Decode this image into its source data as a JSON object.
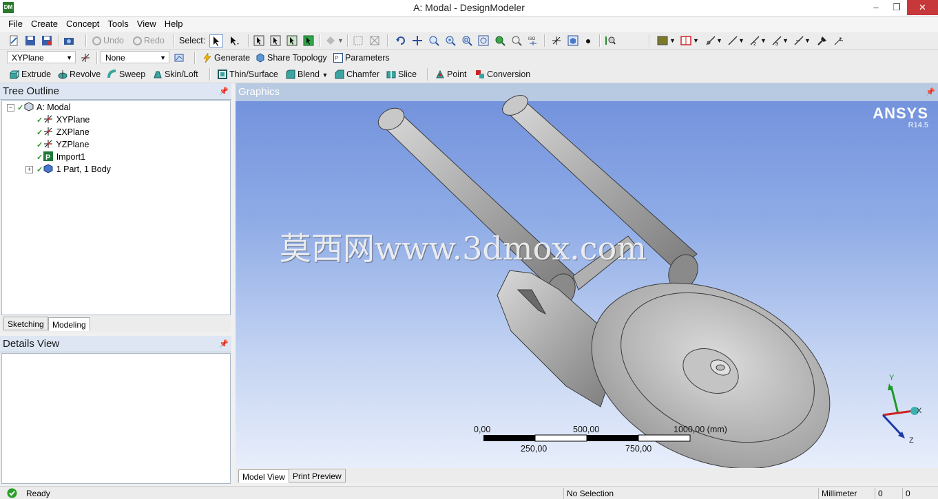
{
  "window": {
    "title": "A: Modal - DesignModeler",
    "app_icon": "DM"
  },
  "menu": [
    "File",
    "Create",
    "Concept",
    "Tools",
    "View",
    "Help"
  ],
  "toolbar1": {
    "undo": "Undo",
    "redo": "Redo",
    "select_label": "Select:"
  },
  "toolbar2": {
    "plane": "XYPlane",
    "sketch": "None",
    "generate": "Generate",
    "share_topology": "Share Topology",
    "parameters": "Parameters"
  },
  "toolbar3": {
    "extrude": "Extrude",
    "revolve": "Revolve",
    "sweep": "Sweep",
    "skin_loft": "Skin/Loft",
    "thin_surface": "Thin/Surface",
    "blend": "Blend",
    "chamfer": "Chamfer",
    "slice": "Slice",
    "point": "Point",
    "conversion": "Conversion"
  },
  "tree_outline": {
    "title": "Tree Outline",
    "nodes": [
      "A: Modal",
      "XYPlane",
      "ZXPlane",
      "YZPlane",
      "Import1",
      "1 Part, 1 Body"
    ],
    "tabs": [
      "Sketching",
      "Modeling"
    ]
  },
  "details_view": {
    "title": "Details View"
  },
  "graphics": {
    "title": "Graphics",
    "brand": "ANSYS",
    "version": "R14.5",
    "watermark": "莫西网www.3dmox.com",
    "scale_top": [
      "0,00",
      "500,00",
      "1000,00 (mm)"
    ],
    "scale_bottom": [
      "250,00",
      "750,00"
    ],
    "axes": {
      "x": "X",
      "y": "Y",
      "z": "Z"
    },
    "tabs": [
      "Model View",
      "Print Preview"
    ]
  },
  "status": {
    "ready": "Ready",
    "selection": "No Selection",
    "units": "Millimeter",
    "v1": "0",
    "v2": "0"
  }
}
